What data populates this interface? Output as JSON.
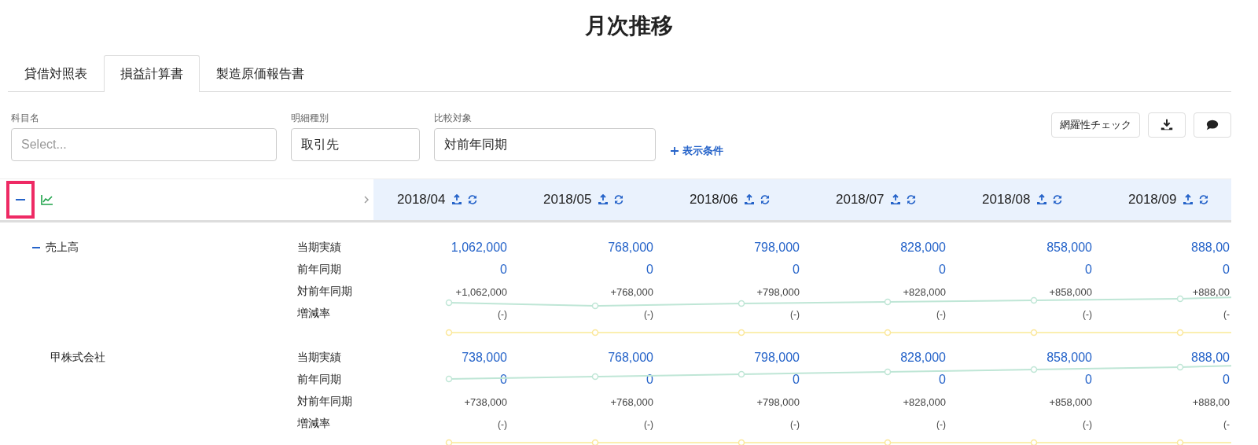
{
  "title": "月次推移",
  "tabs": [
    {
      "label": "貸借対照表",
      "selected": false
    },
    {
      "label": "損益計算書",
      "selected": true
    },
    {
      "label": "製造原価報告書",
      "selected": false
    }
  ],
  "filters": [
    {
      "label": "科目名",
      "placeholder": "Select..."
    },
    {
      "label": "明細種別",
      "value": "取引先"
    },
    {
      "label": "比較対象",
      "value": "対前年同期"
    }
  ],
  "display_conditions_link": "表示条件",
  "buttons": {
    "coverage_check": "網羅性チェック"
  },
  "table": {
    "collapse_all": {
      "highlighted": true
    },
    "columns": [
      {
        "label": "2018/04"
      },
      {
        "label": "2018/05"
      },
      {
        "label": "2018/06"
      },
      {
        "label": "2018/07"
      },
      {
        "label": "2018/08"
      },
      {
        "label": "2018/09"
      }
    ],
    "tree": [
      {
        "name": "売上高",
        "expanded": true,
        "rows": [
          {
            "label": "当期実績",
            "kind": "amount",
            "values": [
              "1,062,000",
              "768,000",
              "798,000",
              "828,000",
              "858,000",
              "888,00"
            ]
          },
          {
            "label": "前年同期",
            "kind": "amount",
            "values": [
              "0",
              "0",
              "0",
              "0",
              "0",
              "0"
            ]
          },
          {
            "label": "対前年同期",
            "kind": "difference",
            "values": [
              "+1,062,000",
              "+768,000",
              "+798,000",
              "+828,000",
              "+858,000",
              "+888,00"
            ]
          },
          {
            "label": "増減率",
            "kind": "rate",
            "values": [
              "(-)",
              "(-)",
              "(-)",
              "(-)",
              "(-)",
              "(-"
            ]
          }
        ],
        "children": [
          {
            "name": "甲株式会社",
            "rows": [
              {
                "label": "当期実績",
                "kind": "amount",
                "values": [
                  "738,000",
                  "768,000",
                  "798,000",
                  "828,000",
                  "858,000",
                  "888,00"
                ]
              },
              {
                "label": "前年同期",
                "kind": "amount",
                "values": [
                  "0",
                  "0",
                  "0",
                  "0",
                  "0",
                  "0"
                ]
              },
              {
                "label": "対前年同期",
                "kind": "difference",
                "values": [
                  "+738,000",
                  "+768,000",
                  "+798,000",
                  "+828,000",
                  "+858,000",
                  "+888,00"
                ]
              },
              {
                "label": "増減率",
                "kind": "rate",
                "values": [
                  "(-)",
                  "(-)",
                  "(-)",
                  "(-)",
                  "(-)",
                  "(-"
                ]
              }
            ]
          }
        ]
      }
    ]
  }
}
